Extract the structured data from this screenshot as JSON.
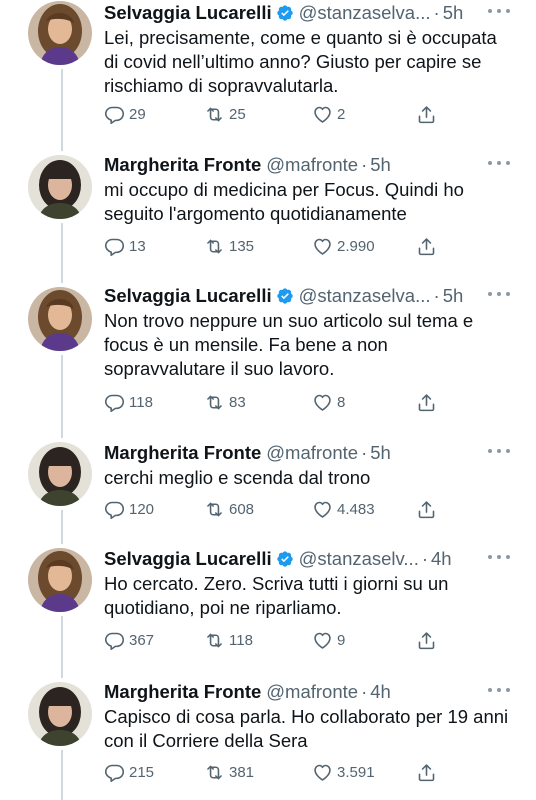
{
  "tweets": [
    {
      "name": "Selvaggia Lucarelli",
      "verified": true,
      "handle": "@stanzaselva...",
      "dot": "·",
      "time": "5h",
      "text": "Lei, precisamente, come e quanto si è occupata di covid nell’ultimo anno? Giusto per capire se rischiamo di sopravvalutarla.",
      "replies": "29",
      "retweets": "25",
      "likes": "2"
    },
    {
      "name": "Margherita Fronte",
      "verified": false,
      "handle": "@mafronte",
      "dot": "·",
      "time": "5h",
      "text": "mi occupo di medicina per Focus. Quindi ho seguito l'argomento quotidianamente",
      "replies": "13",
      "retweets": "135",
      "likes": "2.990"
    },
    {
      "name": "Selvaggia Lucarelli",
      "verified": true,
      "handle": "@stanzaselva...",
      "dot": "·",
      "time": "5h",
      "text": "Non trovo neppure un suo articolo sul tema e focus è un mensile. Fa bene a non sopravvalutare il suo lavoro.",
      "replies": "118",
      "retweets": "83",
      "likes": "8"
    },
    {
      "name": "Margherita Fronte",
      "verified": false,
      "handle": "@mafronte",
      "dot": "·",
      "time": "5h",
      "text": "cerchi meglio e scenda dal trono",
      "replies": "120",
      "retweets": "608",
      "likes": "4.483"
    },
    {
      "name": "Selvaggia Lucarelli",
      "verified": true,
      "handle": "@stanzaselv...",
      "dot": "·",
      "time": "4h",
      "text": "Ho cercato. Zero. Scriva tutti i giorni su un quotidiano, poi ne riparliamo.",
      "replies": "367",
      "retweets": "118",
      "likes": "9"
    },
    {
      "name": "Margherita Fronte",
      "verified": false,
      "handle": "@mafronte",
      "dot": "·",
      "time": "4h",
      "text": "Capisco di cosa parla. Ho collaborato per 19 anni con il Corriere della Sera",
      "replies": "215",
      "retweets": "381",
      "likes": "3.591"
    }
  ],
  "colors": {
    "text": "#0f1419",
    "secondary": "#536471",
    "verified": "#1d9bf0",
    "thread_line": "#cfd9de"
  },
  "icons": {
    "verified": "verified-badge-icon",
    "more": "more-options-icon",
    "reply": "reply-icon",
    "retweet": "retweet-icon",
    "like": "like-heart-icon",
    "share": "share-icon"
  }
}
